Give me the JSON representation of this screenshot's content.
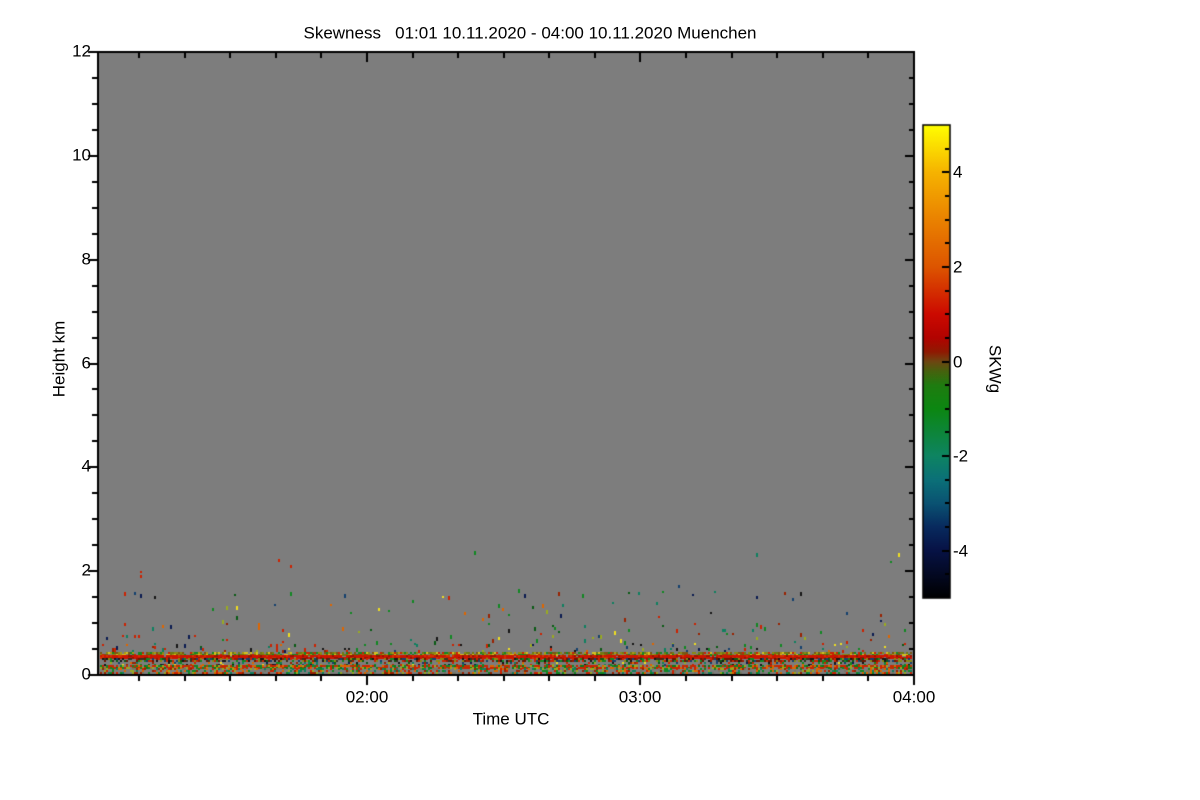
{
  "figure": {
    "background_color": "#ffffff"
  },
  "chart_data": {
    "type": "heatmap",
    "title": "Skewness   01:01 10.11.2020 - 04:00 10.11.2020 Muenchen",
    "variable": "Skewness",
    "site": "Muenchen",
    "time_start": "01:01 10.11.2020",
    "time_end": "04:00 10.11.2020",
    "xlabel": "Time UTC",
    "ylabel": "Height km",
    "ylim": [
      0,
      12
    ],
    "x_duration_minutes": 179,
    "x_ticks": [
      {
        "label": "02:00",
        "minute": 59
      },
      {
        "label": "03:00",
        "minute": 119
      },
      {
        "label": "04:00",
        "minute": 179
      }
    ],
    "x_minor_tick_every_minutes": 10,
    "y_ticks": [
      {
        "label": "12",
        "km": 12
      },
      {
        "label": "10",
        "km": 10
      },
      {
        "label": "8",
        "km": 8
      },
      {
        "label": "6",
        "km": 6
      },
      {
        "label": "4",
        "km": 4
      },
      {
        "label": "2",
        "km": 2
      },
      {
        "label": "0",
        "km": 0
      }
    ],
    "y_minor_tick_km": 0.5,
    "grid": false,
    "no_data_color": "#7d7d7d",
    "frame_color": "#000000",
    "colorbar": {
      "label": "SKWg",
      "position": "right",
      "range": [
        -5,
        5
      ],
      "ticks": [
        {
          "label": "4",
          "value": 4
        },
        {
          "label": "2",
          "value": 2
        },
        {
          "label": "0",
          "value": 0
        },
        {
          "label": "-2",
          "value": -2
        },
        {
          "label": "-4",
          "value": -4
        }
      ],
      "minor_tick_step": 0.5,
      "stops": [
        {
          "value": 5,
          "color": "#ffff00"
        },
        {
          "value": 4,
          "color": "#f6b300"
        },
        {
          "value": 3,
          "color": "#ea8200"
        },
        {
          "value": 2,
          "color": "#dd5500"
        },
        {
          "value": 1,
          "color": "#cc0a00"
        },
        {
          "value": 0.5,
          "color": "#b20300"
        },
        {
          "value": 0.2,
          "color": "#8f1a02"
        },
        {
          "value": 0,
          "color": "#6e4612"
        },
        {
          "value": -0.2,
          "color": "#47610e"
        },
        {
          "value": -0.5,
          "color": "#1f7c10"
        },
        {
          "value": -1,
          "color": "#0c8712"
        },
        {
          "value": -2,
          "color": "#0e8462"
        },
        {
          "value": -2.5,
          "color": "#0b7078"
        },
        {
          "value": -3,
          "color": "#0a5272"
        },
        {
          "value": -3.5,
          "color": "#082a5e"
        },
        {
          "value": -4,
          "color": "#071245"
        },
        {
          "value": -5,
          "color": "#000000"
        }
      ]
    },
    "speckle_palette": [
      "#cc2200",
      "#992200",
      "#dd6600",
      "#eedd22",
      "#99aa22",
      "#118822",
      "#0a5a14",
      "#0e8060",
      "#13406e",
      "#0a1a50",
      "#151515",
      "#cc2200",
      "#118822"
    ],
    "features": [
      {
        "name": "rare-speckle-layer",
        "height_km": [
          1.6,
          2.65
        ],
        "density": 0.0012,
        "dash": true
      },
      {
        "name": "upper-sparse-layer",
        "height_km": [
          1.0,
          1.6
        ],
        "density": 0.008,
        "dash": true
      },
      {
        "name": "mid-sparse-layer",
        "height_km": [
          0.6,
          1.0
        ],
        "density": 0.018,
        "dash": true
      },
      {
        "name": "lower-sparse-layer",
        "height_km": [
          0.44,
          0.6
        ],
        "density": 0.045,
        "dash": true
      },
      {
        "name": "olive-line",
        "height_km": [
          0.385,
          0.44
        ],
        "density": 0.8,
        "palette": [
          "#8a8a10",
          "#6f7a10",
          "#aa9911",
          "#cc2200",
          "#118822",
          "#d4c020",
          "#7a5510"
        ]
      },
      {
        "name": "persistent-red-line",
        "height_km": [
          0.327,
          0.385
        ],
        "density": 0.97,
        "palette": [
          "#cc1400",
          "#cc1400",
          "#cc1400",
          "#c81800",
          "#d43000",
          "#9a1200",
          "#cc1400"
        ]
      },
      {
        "name": "dark-mixed-band",
        "height_km": [
          0.25,
          0.327
        ],
        "density": 0.72,
        "palette": [
          "#991800",
          "#6b1500",
          "#151515",
          "#0a5a14",
          "#118822",
          "#8a8a10",
          "#13406e",
          "#cc2200",
          "#333322"
        ]
      },
      {
        "name": "speckled-gap-band",
        "height_km": [
          0.193,
          0.25
        ],
        "density": 0.3
      },
      {
        "name": "red-green-line",
        "height_km": [
          0.135,
          0.193
        ],
        "density": 0.85,
        "palette": [
          "#cc2200",
          "#bb3300",
          "#118822",
          "#0c7a18",
          "#dd6600",
          "#99aa22",
          "#cc2200"
        ]
      },
      {
        "name": "bottom-mixed-band",
        "height_km": [
          0.04,
          0.135
        ],
        "density": 0.5,
        "palette": [
          "#cc2200",
          "#118822",
          "#99aa22",
          "#dd6600",
          "#0e8060",
          "#992200",
          "#777766"
        ]
      }
    ]
  }
}
